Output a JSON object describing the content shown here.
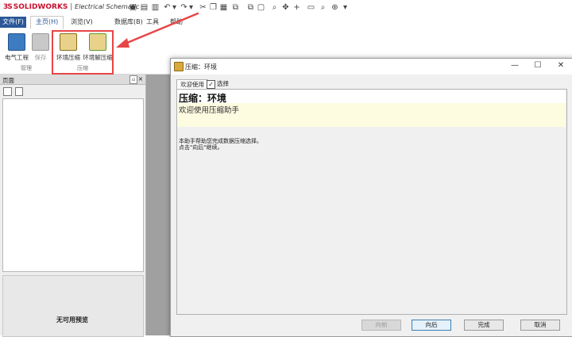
{
  "app": {
    "logo_ds": "3S",
    "logo_brand": "SOLIDWORKS",
    "logo_sep": " | ",
    "logo_product": "Electrical Schematic"
  },
  "ribbon": {
    "tabs": [
      {
        "label": "文件(F)"
      },
      {
        "label": "主页(H)"
      },
      {
        "label": "浏览(V)"
      },
      {
        "label": "数据库(B)"
      },
      {
        "label": "工具"
      },
      {
        "label": "帮助"
      }
    ],
    "groups": {
      "manage": {
        "label": "管理",
        "buttons": [
          {
            "label": "电气工程"
          },
          {
            "label": "保存"
          }
        ]
      },
      "compress": {
        "label": "压缩",
        "buttons": [
          {
            "label": "环境压缩"
          },
          {
            "label": "环境解压缩"
          }
        ],
        "dropdown_marker": "-"
      }
    }
  },
  "left_panel": {
    "title": "页面",
    "pin": "▫",
    "close": "×",
    "preview_label": "无可用预览"
  },
  "dialog": {
    "title": "压缩：环境",
    "tabs": {
      "welcome": "欢迎使用",
      "select": "选择",
      "select_checked": "✓"
    },
    "heading": "压缩：环境",
    "subheading": "欢迎使用压缩助手",
    "desc_line1": "本助手帮助您完成数据压缩选择。",
    "desc_line2": "点击\"向后\"继续。",
    "buttons": {
      "back": "向前",
      "next": "向后",
      "finish": "完成",
      "cancel": "取消"
    },
    "window": {
      "minimize": "—",
      "maximize": "☐",
      "close": "✕"
    }
  },
  "colors": {
    "file_tab": "#2b5797",
    "annotation": "#e84545",
    "banner": "#fdfbe0",
    "workspace": "#a0a0a0"
  }
}
